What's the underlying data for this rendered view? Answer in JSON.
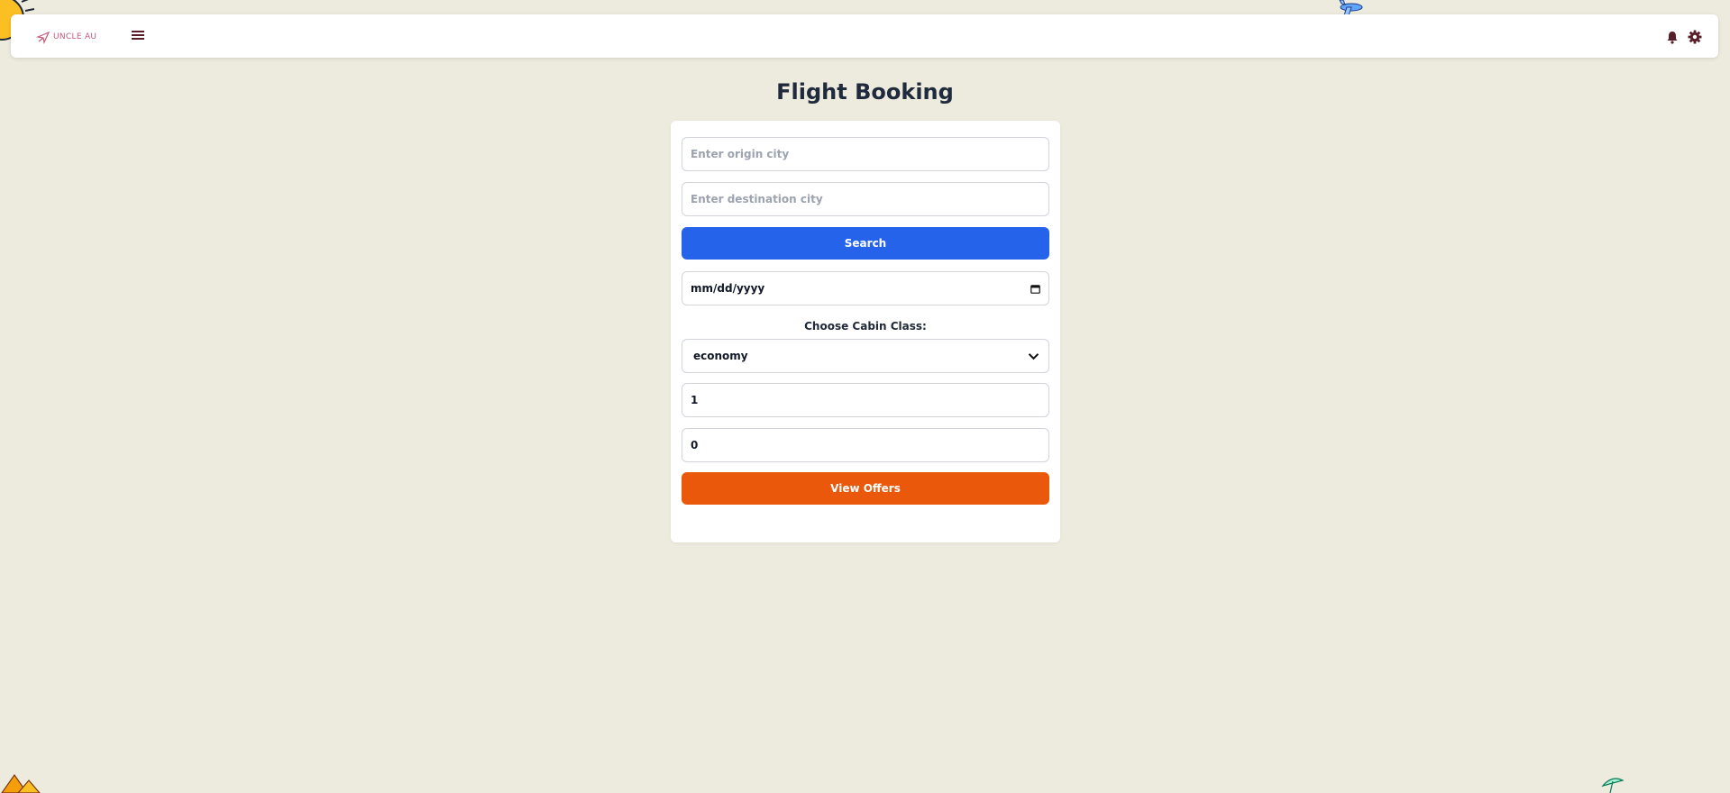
{
  "brand": {
    "name": "UNCLE AU"
  },
  "header": {
    "icons": [
      "menu-icon",
      "bell-icon",
      "gear-icon"
    ],
    "accent_color": "#5a1e2a"
  },
  "page": {
    "title": "Flight Booking"
  },
  "form": {
    "origin_placeholder": "Enter origin city",
    "destination_placeholder": "Enter destination city",
    "search_label": "Search",
    "date_value": "mm/dd/yyyy",
    "cabin_label": "Choose Cabin Class:",
    "cabin_selected": "economy",
    "adults_value": "1",
    "children_value": "0",
    "offers_label": "View Offers"
  },
  "colors": {
    "background": "#edeade",
    "search_button": "#2563eb",
    "offers_button": "#ea580c",
    "logo": "#c35a79"
  }
}
